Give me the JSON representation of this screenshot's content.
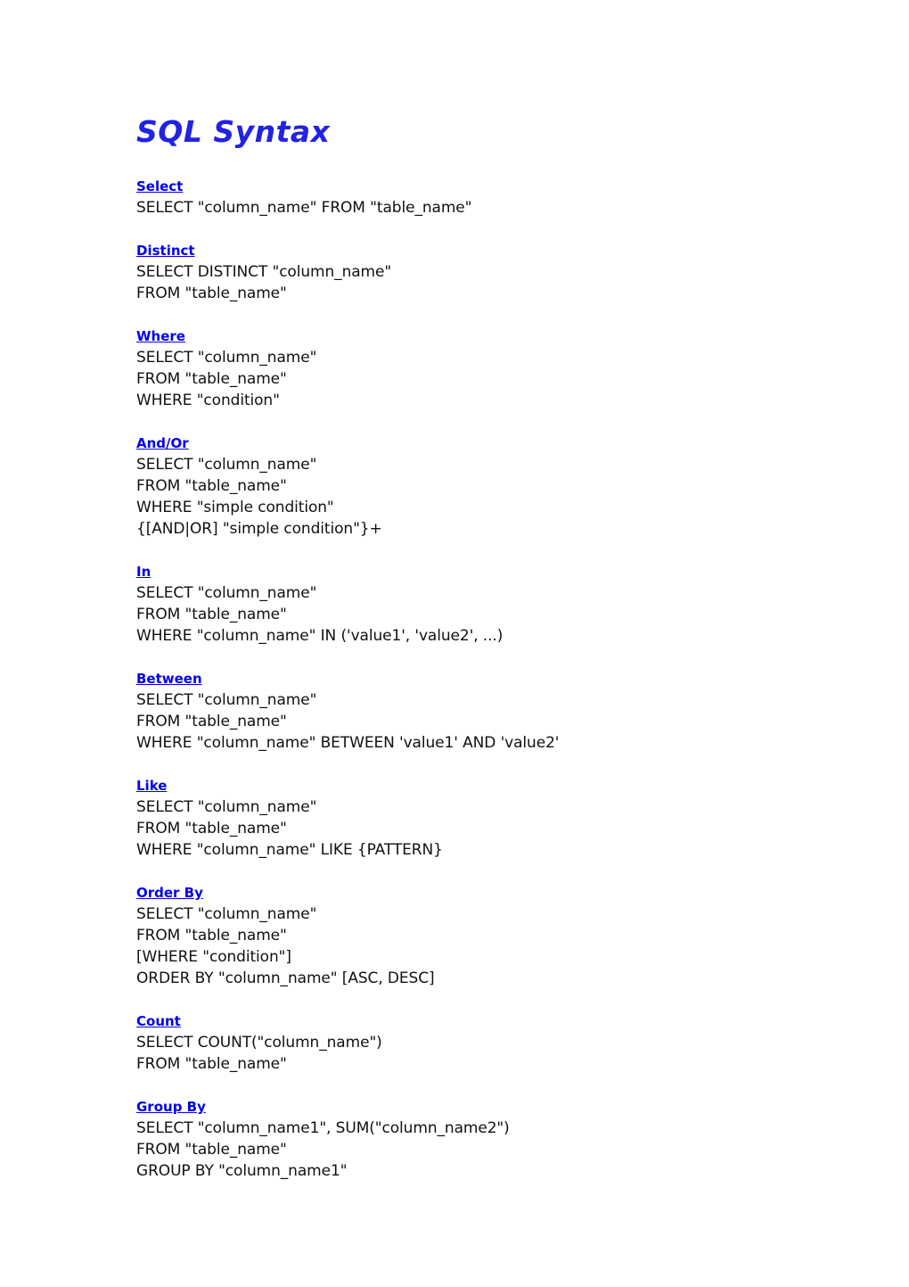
{
  "document": {
    "title": "SQL Syntax",
    "title_color": "#2222E2",
    "heading_color": "#0000EE",
    "body_color": "#111111",
    "background_color": "#ffffff"
  },
  "sections": [
    {
      "heading": "Select",
      "lines": [
        "SELECT \"column_name\" FROM \"table_name\""
      ]
    },
    {
      "heading": "Distinct",
      "lines": [
        "SELECT DISTINCT \"column_name\"",
        "FROM \"table_name\""
      ]
    },
    {
      "heading": "Where",
      "lines": [
        "SELECT \"column_name\"",
        "FROM \"table_name\"",
        "WHERE \"condition\""
      ]
    },
    {
      "heading": "And/Or",
      "lines": [
        "SELECT \"column_name\"",
        "FROM \"table_name\"",
        "WHERE \"simple condition\"",
        "{[AND|OR] \"simple condition\"}+"
      ]
    },
    {
      "heading": "In",
      "lines": [
        "SELECT \"column_name\"",
        "FROM \"table_name\"",
        "WHERE \"column_name\" IN ('value1', 'value2', ...)"
      ]
    },
    {
      "heading": "Between",
      "lines": [
        "SELECT \"column_name\"",
        "FROM \"table_name\"",
        "WHERE \"column_name\" BETWEEN 'value1' AND 'value2'"
      ]
    },
    {
      "heading": "Like",
      "lines": [
        "SELECT \"column_name\"",
        "FROM \"table_name\"",
        "WHERE \"column_name\" LIKE {PATTERN}"
      ]
    },
    {
      "heading": "Order By",
      "lines": [
        "SELECT \"column_name\"",
        "FROM \"table_name\"",
        "[WHERE \"condition\"]",
        "ORDER BY \"column_name\" [ASC, DESC]"
      ]
    },
    {
      "heading": "Count",
      "lines": [
        "SELECT COUNT(\"column_name\")",
        "FROM \"table_name\""
      ]
    },
    {
      "heading": "Group By",
      "lines": [
        "SELECT \"column_name1\", SUM(\"column_name2\")",
        "FROM \"table_name\"",
        "GROUP BY \"column_name1\""
      ]
    }
  ]
}
